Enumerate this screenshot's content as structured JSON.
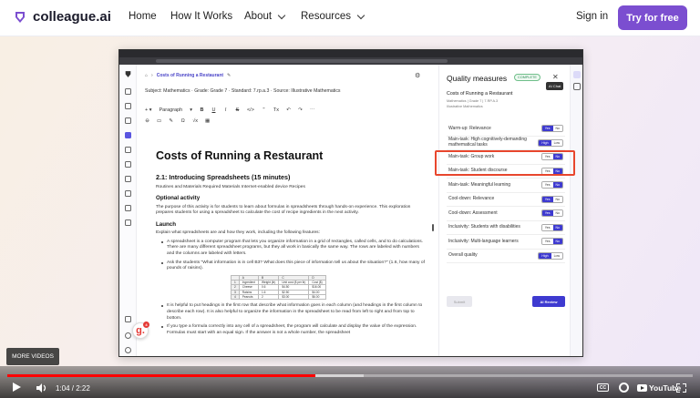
{
  "site": {
    "brand": "colleague.ai",
    "nav": [
      {
        "label": "Home"
      },
      {
        "label": "How It Works"
      },
      {
        "label": "About"
      },
      {
        "label": "Resources"
      }
    ],
    "signin": "Sign in",
    "cta": "Try for free",
    "brand_color": "#7b4ed0"
  },
  "app": {
    "breadcrumb": {
      "title": "Costs of Running a Restaurant"
    },
    "meta": "Subject: Mathematics  ·  Grade: Grade 7  ·  Standard: 7.rp.a.3  ·  Source: Illustrative Mathematics",
    "toolbar": {
      "style_select": "Paragraph",
      "row1": [
        "B",
        "U",
        "I",
        "S",
        "</>",
        "\"",
        "Tx",
        "↶",
        "↷",
        "⋯"
      ],
      "row2": [
        "⊖",
        "▭",
        "✎",
        "Ω",
        "√x",
        "▦"
      ]
    },
    "doc": {
      "title": "Costs of Running a Restaurant",
      "section": "2.1: Introducing Spreadsheets (15 minutes)",
      "routines": "Routines and Materials Required Materials Internet-enabled device Recipes",
      "optional_heading": "Optional activity",
      "optional_text": "The purpose of this activity is for students to learn about formulas in spreadsheets through hands-on experience. This exploration prepares students for using a spreadsheet to calculate the cost of recipe ingredients in the next activity.",
      "launch_heading": "Launch",
      "launch_text": "Explain what spreadsheets are and how they work, including the following features:",
      "bullets1": [
        "A spreadsheet is a computer program that lets you organize information in a grid of rectangles, called cells, and to do calculations. There are many different spreadsheet programs, but they all work in basically the same way. The rows are labeled with numbers and the columns are labeled with letters.",
        "Ask the students \"What information is in cell B3? What does this piece of information tell us about the situation?\" (1.6, how many of pounds of raisins)."
      ],
      "table": [
        [
          "",
          "A",
          "B",
          "C",
          "D"
        ],
        [
          "1",
          "Ingredient",
          "Weight (lb)",
          "Unit cost ($ per lb)",
          "Cost ($)"
        ],
        [
          "2",
          "Cheese",
          "0.6",
          "$4.50",
          "$16.00"
        ],
        [
          "3",
          "Raisins",
          "1.6",
          "$2.50",
          "$4.00"
        ],
        [
          "4",
          "Peanuts",
          "2",
          "$3.00",
          "$6.00"
        ]
      ],
      "bullets2": [
        "It is helpful to put headings in the first row that describe what information goes in each column (and headings in the first column to describe each row). It is also helpful to organize the information in the spreadsheet to be read from left to right and from top to bottom.",
        "If you type a formula correctly into any cell of a spreadsheet, the program will calculate and display the value of the expression. Formulas must start with an equal sign. If the answer is not a whole number, the spreadsheet"
      ]
    },
    "quality": {
      "title": "Quality measures",
      "status": "COMPLETE",
      "tooltip": "AI Chat",
      "lesson": "Costs of Running a Restaurant",
      "sub1": "Mathematics | Grade 7 | 7.RP.A.3",
      "sub2": "Illustrative Mathematics",
      "rows": [
        {
          "label": "Warm-up: Relevance",
          "options": [
            "Yes",
            "No"
          ],
          "selected": 0
        },
        {
          "label": "Main-task: High cognitively-demanding mathematical tasks",
          "options": [
            "High",
            "Low"
          ],
          "selected": 0
        },
        {
          "label": "Main-task: Group work",
          "options": [
            "Yes",
            "No"
          ],
          "selected": 1
        },
        {
          "label": "Main-task: Student discourse",
          "options": [
            "Yes",
            "No"
          ],
          "selected": 1
        },
        {
          "label": "Main-task: Meaningful learning",
          "options": [
            "Yes",
            "No"
          ],
          "selected": 1
        },
        {
          "label": "Cool-down: Relevance",
          "options": [
            "Yes",
            "No"
          ],
          "selected": 0
        },
        {
          "label": "Cool-down: Assessment",
          "options": [
            "Yes",
            "No"
          ],
          "selected": 0
        },
        {
          "label": "Inclusivity: Students with disabilities",
          "options": [
            "Yes",
            "No"
          ],
          "selected": 1
        },
        {
          "label": "Inclusivity: Multi-language learners",
          "options": [
            "Yes",
            "No"
          ],
          "selected": 1
        },
        {
          "label": "Overall quality",
          "options": [
            "High",
            "Low"
          ],
          "selected": 0
        }
      ],
      "submit": "Submit",
      "ai_review": "AI Review",
      "accent": "#3e3ad0"
    },
    "assistant_badge": {
      "letter": "g.",
      "count": "4"
    }
  },
  "player": {
    "more_videos": "MORE VIDEOS",
    "time": "1:04 / 2:22",
    "progress": 0.45,
    "buffered": 0.52,
    "cc": "CC",
    "brand": "YouTube"
  }
}
